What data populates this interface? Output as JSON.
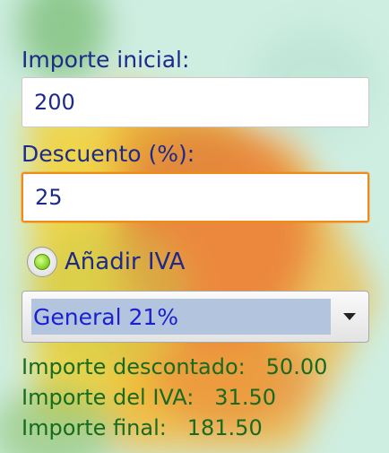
{
  "form": {
    "initial_amount_label": "Importe inicial:",
    "initial_amount_value": "200",
    "discount_label": "Descuento (%):",
    "discount_value": "25",
    "add_vat_label": "Añadir IVA",
    "add_vat_checked": true,
    "vat_type_selected": "General 21%"
  },
  "results": {
    "discounted_label": "Importe descontado:",
    "discounted_value": "50.00",
    "vat_label": "Importe del IVA:",
    "vat_value": "31.50",
    "final_label": "Importe final:",
    "final_value": "181.50"
  },
  "colors": {
    "background": "#cfeee2",
    "label_text": "#1e2a8a",
    "result_text": "#176b20",
    "focus_border": "#f08a1a",
    "spinner_highlight": "#b3c5de"
  }
}
